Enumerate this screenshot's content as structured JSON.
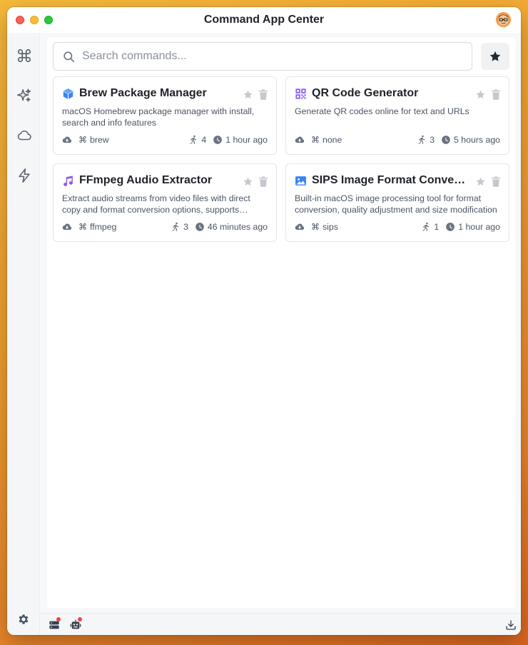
{
  "window": {
    "title": "Command App Center"
  },
  "search": {
    "placeholder": "Search commands..."
  },
  "cards": [
    {
      "title": "Brew Package Manager",
      "description": "macOS Homebrew package manager with install, search and info features",
      "command": "brew",
      "runs": "4",
      "time": "1 hour ago",
      "icon": "cube-icon",
      "icon_color": "#3b82f6"
    },
    {
      "title": "QR Code Generator",
      "description": "Generate QR codes online for text and URLs",
      "command": "none",
      "runs": "3",
      "time": "5 hours ago",
      "icon": "qrcode-icon",
      "icon_color": "#8b5cf6"
    },
    {
      "title": "FFmpeg Audio Extractor",
      "description": "Extract audio streams from video files with direct copy and format conversion options, supports multiple audio formats",
      "command": "ffmpeg",
      "runs": "3",
      "time": "46 minutes ago",
      "icon": "music-icon",
      "icon_color": "#8b5cf6"
    },
    {
      "title": "SIPS Image Format Converter",
      "description": "Built-in macOS image processing tool for format conversion, quality adjustment and size modification",
      "command": "sips",
      "runs": "1",
      "time": "1 hour ago",
      "icon": "image-icon",
      "icon_color": "#3b82f6"
    }
  ],
  "colors": {
    "accent_red": "#ef4444",
    "text": "#1f2328",
    "muted": "#4b5563"
  }
}
